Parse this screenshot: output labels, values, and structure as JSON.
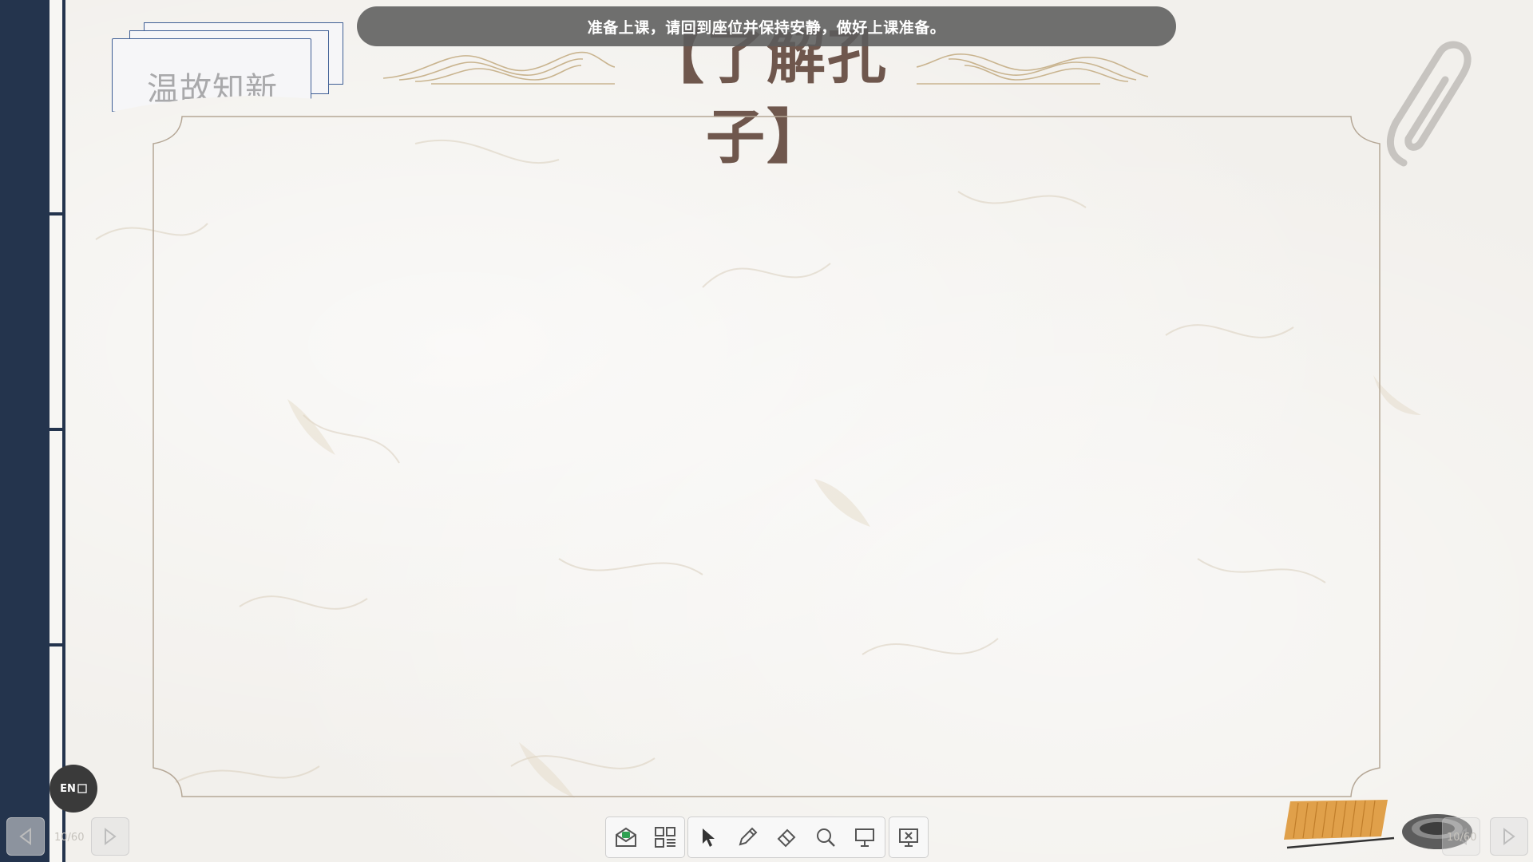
{
  "notification": {
    "text": "准备上课，请回到座位并保持安静，做好上课准备。"
  },
  "slide": {
    "section_tag": "温故知新",
    "title": "【了解孔子】"
  },
  "navigation": {
    "left_page": "10/60",
    "right_page": "10/60"
  },
  "ime": {
    "label": "EN"
  },
  "toolbar": {
    "group1": [
      {
        "icon": "classroom-envelope-icon"
      },
      {
        "icon": "apps-grid-icon"
      }
    ],
    "group2": [
      {
        "icon": "pointer-arrow-icon"
      },
      {
        "icon": "pen-icon"
      },
      {
        "icon": "eraser-icon"
      },
      {
        "icon": "search-icon"
      },
      {
        "icon": "screen-board-icon"
      }
    ],
    "group3": [
      {
        "icon": "close-presentation-icon"
      }
    ]
  },
  "colors": {
    "binding": "#24344d",
    "title": "#6f574d",
    "frame": "#b5a796",
    "accent_blue": "#3f5f95"
  }
}
